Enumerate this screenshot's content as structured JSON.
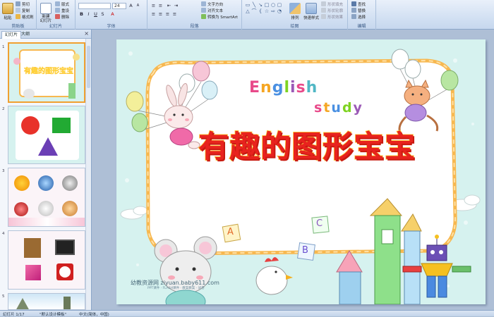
{
  "ribbon": {
    "clipboard": {
      "paste": "粘贴",
      "cut": "剪切",
      "copy": "复制",
      "format_painter": "格式刷",
      "label": "剪贴板"
    },
    "slides": {
      "new_slide": "新建\n幻灯片",
      "layout": "版式",
      "reset": "重设",
      "delete": "删除",
      "label": "幻灯片"
    },
    "font": {
      "name": "",
      "size": "24",
      "label": "字体"
    },
    "paragraph": {
      "text_direction": "文字方向",
      "align_text": "对齐文本",
      "smartart": "转换为 SmartArt",
      "label": "段落"
    },
    "drawing": {
      "arrange": "排列",
      "quick_styles": "快速样式",
      "shape_fill": "形状填充",
      "shape_outline": "形状轮廓",
      "shape_effects": "形状效果",
      "label": "绘图"
    },
    "editing": {
      "find": "查找",
      "replace": "替换",
      "select": "选择",
      "label": "编辑"
    }
  },
  "leftpane": {
    "tabs": [
      "幻灯片",
      "大纲"
    ],
    "close": "×",
    "slide_numbers": [
      "1",
      "2",
      "3",
      "4",
      "5"
    ],
    "thumb1_title": "有趣的图形宝宝"
  },
  "slide": {
    "title": "有趣的图形宝宝",
    "english": "English",
    "study": "study",
    "letters": [
      "A",
      "B",
      "C"
    ],
    "watermark": "幼教资源网 ziyuan.baby611.com",
    "watermark_sub": "PPT课件 · FLASH课件 · 教案教案 · 试卷"
  },
  "statusbar": {
    "slide_info": "幻灯片 1/17",
    "theme": "\"默认设计模板\"",
    "language": "中文(简体，中国)"
  },
  "colors": {
    "title_fill": "#e8231e",
    "title_stroke": "#ffd23a",
    "slide_bg": "#d6f2ef",
    "frame": "#f7b850",
    "english": [
      "#e84a8a",
      "#f5a623",
      "#4a90e2",
      "#7ed321",
      "#9b59b6",
      "#e84a8a",
      "#50b7c5"
    ]
  }
}
